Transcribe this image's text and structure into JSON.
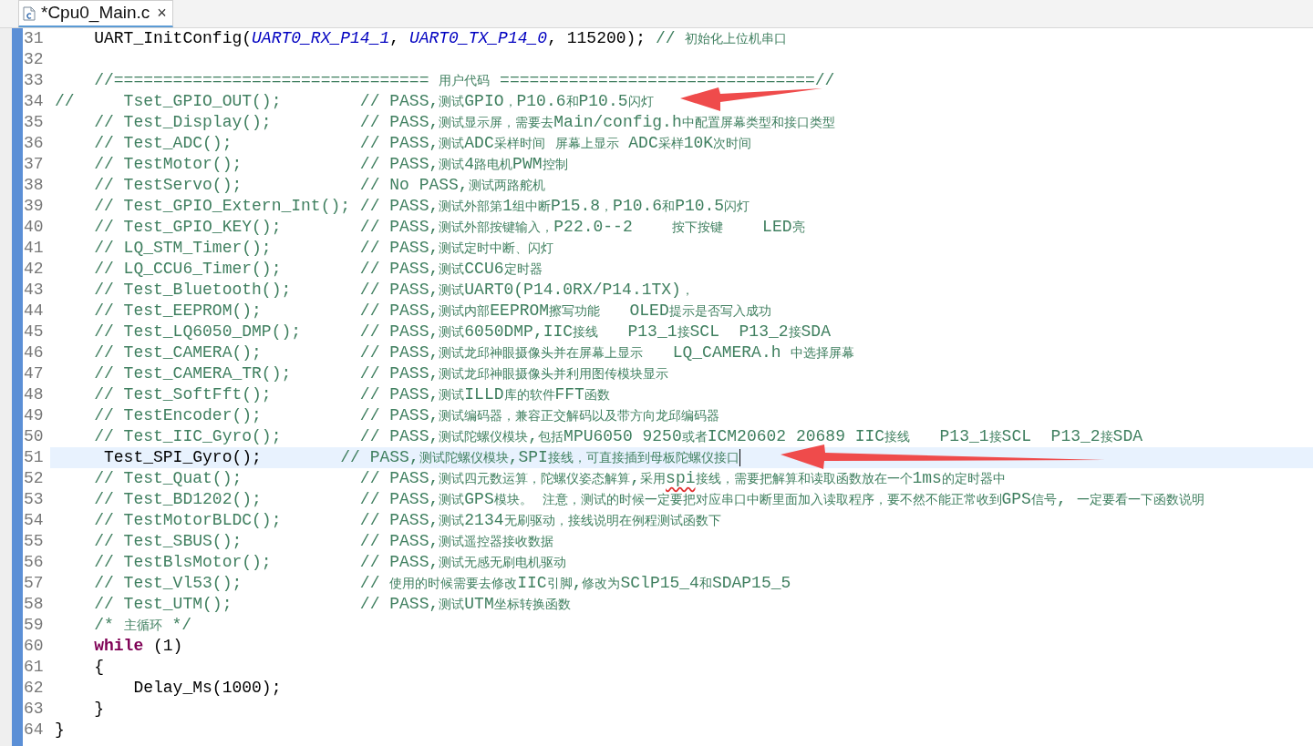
{
  "tab": {
    "title": "*Cpu0_Main.c",
    "close": "×",
    "selected": true
  },
  "lines": [
    {
      "number": "31",
      "current": false,
      "segments": [
        {
          "kind": "code",
          "text": "    UART_InitConfig("
        },
        {
          "kind": "macro",
          "text": "UART0_RX_P14_1"
        },
        {
          "kind": "code",
          "text": ", "
        },
        {
          "kind": "macro",
          "text": "UART0_TX_P14_0"
        },
        {
          "kind": "code",
          "text": ", 115200); "
        },
        {
          "kind": "comment",
          "text": "// 初始化上位机串口"
        }
      ]
    },
    {
      "number": "32",
      "current": false
    },
    {
      "number": "33",
      "current": false,
      "segments": [
        {
          "kind": "comment",
          "text": "    //================================ 用户代码 ================================//"
        }
      ]
    },
    {
      "number": "34",
      "current": false,
      "segments": [
        {
          "kind": "comment",
          "text": "//     Tset_GPIO_OUT();        // PASS,测试GPIO，P10.6和P10.5闪灯"
        }
      ]
    },
    {
      "number": "35",
      "current": false,
      "segments": [
        {
          "kind": "comment",
          "text": "    // Test_Display();         // PASS,测试显示屏，需要去Main/config.h中配置屏幕类型和接口类型"
        }
      ]
    },
    {
      "number": "36",
      "current": false,
      "segments": [
        {
          "kind": "comment",
          "text": "    // Test_ADC();             // PASS,测试ADC采样时间 屏幕上显示 ADC采样10K次时间"
        }
      ]
    },
    {
      "number": "37",
      "current": false,
      "segments": [
        {
          "kind": "comment",
          "text": "    // TestMotor();            // PASS,测试4路电机PWM控制"
        }
      ]
    },
    {
      "number": "38",
      "current": false,
      "segments": [
        {
          "kind": "comment",
          "text": "    // TestServo();            // No PASS,测试两路舵机"
        }
      ]
    },
    {
      "number": "39",
      "current": false,
      "segments": [
        {
          "kind": "comment",
          "text": "    // Test_GPIO_Extern_Int(); // PASS,测试外部第1组中断P15.8，P10.6和P10.5闪灯"
        }
      ]
    },
    {
      "number": "40",
      "current": false,
      "segments": [
        {
          "kind": "comment",
          "text": "    // Test_GPIO_KEY();        // PASS,测试外部按键输入，P22.0--2    按下按键    LED亮"
        }
      ]
    },
    {
      "number": "41",
      "current": false,
      "segments": [
        {
          "kind": "comment",
          "text": "    // LQ_STM_Timer();         // PASS,测试定时中断、闪灯"
        }
      ]
    },
    {
      "number": "42",
      "current": false,
      "segments": [
        {
          "kind": "comment",
          "text": "    // LQ_CCU6_Timer();        // PASS,测试CCU6定时器"
        }
      ]
    },
    {
      "number": "43",
      "current": false,
      "segments": [
        {
          "kind": "comment",
          "text": "    // Test_Bluetooth();       // PASS,测试UART0(P14.0RX/P14.1TX)，"
        }
      ]
    },
    {
      "number": "44",
      "current": false,
      "segments": [
        {
          "kind": "comment",
          "text": "    // Test_EEPROM();          // PASS,测试内部EEPROM擦写功能   OLED提示是否写入成功"
        }
      ]
    },
    {
      "number": "45",
      "current": false,
      "segments": [
        {
          "kind": "comment",
          "text": "    // Test_LQ6050_DMP();      // PASS,测试6050DMP,IIC接线   P13_1接SCL  P13_2接SDA"
        }
      ]
    },
    {
      "number": "46",
      "current": false,
      "segments": [
        {
          "kind": "comment",
          "text": "    // Test_CAMERA();          // PASS,测试龙邱神眼摄像头并在屏幕上显示   LQ_CAMERA.h 中选择屏幕"
        }
      ]
    },
    {
      "number": "47",
      "current": false,
      "segments": [
        {
          "kind": "comment",
          "text": "    // Test_CAMERA_TR();       // PASS,测试龙邱神眼摄像头并利用图传模块显示"
        }
      ]
    },
    {
      "number": "48",
      "current": false,
      "segments": [
        {
          "kind": "comment",
          "text": "    // Test_SoftFft();         // PASS,测试ILLD库的软件FFT函数"
        }
      ]
    },
    {
      "number": "49",
      "current": false,
      "segments": [
        {
          "kind": "comment",
          "text": "    // TestEncoder();          // PASS,测试编码器，兼容正交解码以及带方向龙邱编码器"
        }
      ]
    },
    {
      "number": "50",
      "current": false,
      "segments": [
        {
          "kind": "comment",
          "text": "    // Test_IIC_Gyro();        // PASS,测试陀螺仪模块,包括MPU6050 9250或者ICM20602 20689 IIC接线   P13_1接SCL  P13_2接SDA"
        }
      ]
    },
    {
      "number": "51",
      "current": true,
      "segments": [
        {
          "kind": "code",
          "text": "     Test_SPI_Gyro();        "
        },
        {
          "kind": "comment",
          "text": "// PASS,测试陀螺仪模块,SPI接线，可直接插到母板陀螺仪接口"
        }
      ]
    },
    {
      "number": "52",
      "current": false,
      "segments": [
        {
          "kind": "comment",
          "text": "    // Test_Quat();            // PASS,测试四元数运算，陀螺仪姿态解算,采用"
        },
        {
          "kind": "misspelled",
          "text": "spi"
        },
        {
          "kind": "comment",
          "text": "接线，需要把解算和读取函数放在一个1ms的定时器中"
        }
      ]
    },
    {
      "number": "53",
      "current": false,
      "segments": [
        {
          "kind": "comment",
          "text": "    // Test_BD1202();          // PASS,测试GPS模块。 注意，测试的时候一定要把对应串口中断里面加入读取程序，要不然不能正常收到GPS信号, 一定要看一下函数说明"
        }
      ]
    },
    {
      "number": "54",
      "current": false,
      "segments": [
        {
          "kind": "comment",
          "text": "    // TestMotorBLDC();        // PASS,测试2134无刷驱动，接线说明在例程测试函数下"
        }
      ]
    },
    {
      "number": "55",
      "current": false,
      "segments": [
        {
          "kind": "comment",
          "text": "    // Test_SBUS();            // PASS,测试遥控器接收数据"
        }
      ]
    },
    {
      "number": "56",
      "current": false,
      "segments": [
        {
          "kind": "comment",
          "text": "    // TestBlsMotor();         // PASS,测试无感无刷电机驱动"
        }
      ]
    },
    {
      "number": "57",
      "current": false,
      "segments": [
        {
          "kind": "comment",
          "text": "    // Test_Vl53();            // 使用的时候需要去修改IIC引脚,修改为SClP15_4和SDAP15_5"
        }
      ]
    },
    {
      "number": "58",
      "current": false,
      "segments": [
        {
          "kind": "comment",
          "text": "    // Test_UTM();             // PASS,测试UTM坐标转换函数"
        }
      ]
    },
    {
      "number": "59",
      "current": false,
      "segments": [
        {
          "kind": "comment",
          "text": "    /* 主循环 */"
        }
      ]
    },
    {
      "number": "60",
      "current": false,
      "segments": [
        {
          "kind": "keyword",
          "text": "    while"
        },
        {
          "kind": "code",
          "text": " (1)"
        }
      ]
    },
    {
      "number": "61",
      "current": false,
      "segments": [
        {
          "kind": "code",
          "text": "    {"
        }
      ]
    },
    {
      "number": "62",
      "current": false,
      "segments": [
        {
          "kind": "code",
          "text": "        Delay_Ms(1000);"
        }
      ]
    },
    {
      "number": "63",
      "current": false,
      "segments": [
        {
          "kind": "code",
          "text": "    }"
        }
      ]
    },
    {
      "number": "64",
      "current": false,
      "segments": [
        {
          "kind": "code",
          "text": "}"
        }
      ]
    }
  ]
}
